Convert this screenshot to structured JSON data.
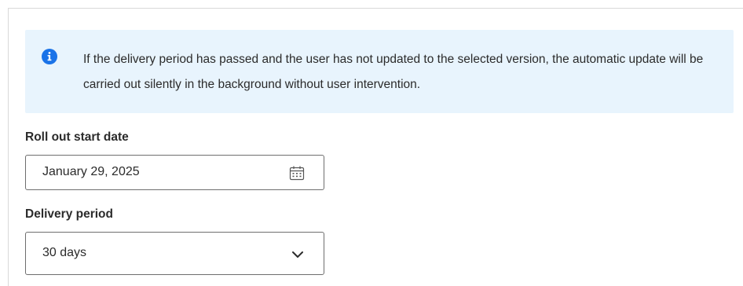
{
  "info_banner": {
    "icon": "info-icon",
    "text": "If the delivery period has passed and the user has not updated to the selected version, the automatic update will be carried out silently in the background without user intervention.",
    "background": "#e8f4fd",
    "icon_color": "#1a73e8"
  },
  "rollout_start": {
    "label": "Roll out start date",
    "value": "January 29, 2025",
    "icon": "calendar-icon"
  },
  "delivery_period": {
    "label": "Delivery period",
    "selected": "30 days",
    "icon": "chevron-down-icon"
  }
}
